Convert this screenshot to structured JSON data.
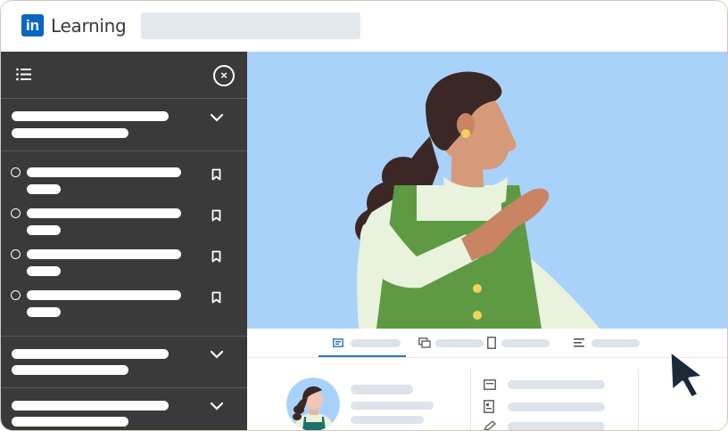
{
  "header": {
    "logo_mark": "in",
    "brand_name": "Learning",
    "search_placeholder": ""
  },
  "sidebar": {
    "toc_icon": "list-icon",
    "close_icon": "close-icon",
    "close_glyph": "×",
    "sections": [
      {
        "expanded": true,
        "icon": "chevron-down-icon"
      },
      {
        "expanded": false,
        "icon": "chevron-down-icon"
      },
      {
        "expanded": false,
        "icon": "chevron-down-icon"
      }
    ],
    "items_count_visible": 4,
    "item_icon": "bookmark-icon"
  },
  "video": {
    "background": "#a9d2fb",
    "illustration": "woman-looking-away"
  },
  "tabs": [
    {
      "icon": "overview-icon",
      "active": true
    },
    {
      "icon": "qa-icon",
      "active": false
    },
    {
      "icon": "notebook-icon",
      "active": false
    },
    {
      "icon": "transcript-icon",
      "active": false
    }
  ],
  "colors": {
    "brand": "#0a66c2",
    "sidebar_bg": "#3a3a3a",
    "accent": "#2572c6",
    "placeholder_bar": "#dde3ea"
  }
}
